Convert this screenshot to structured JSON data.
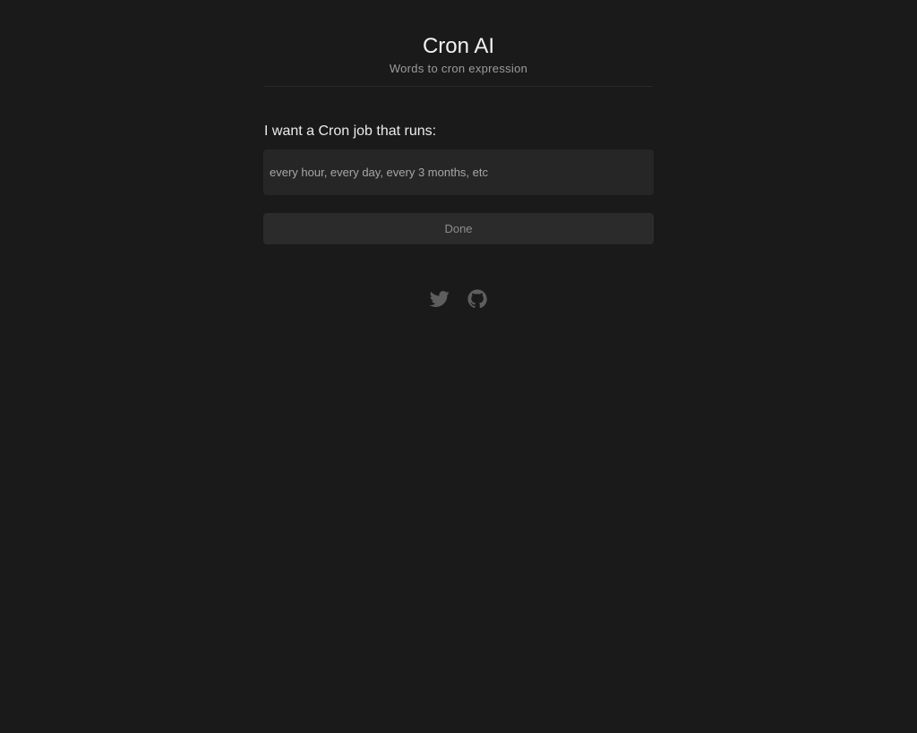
{
  "header": {
    "title": "Cron AI",
    "subtitle": "Words to cron expression"
  },
  "form": {
    "prompt_label": "I want a Cron job that runs:",
    "input_placeholder": "every hour, every day, every 3 months, etc",
    "input_value": "",
    "done_label": "Done"
  },
  "social": {
    "icons": [
      "twitter-icon",
      "github-icon"
    ]
  },
  "colors": {
    "background": "#1a1a1a",
    "input_bg": "#262626",
    "button_bg": "#2b2b2b",
    "icon": "#5e5e5e"
  }
}
